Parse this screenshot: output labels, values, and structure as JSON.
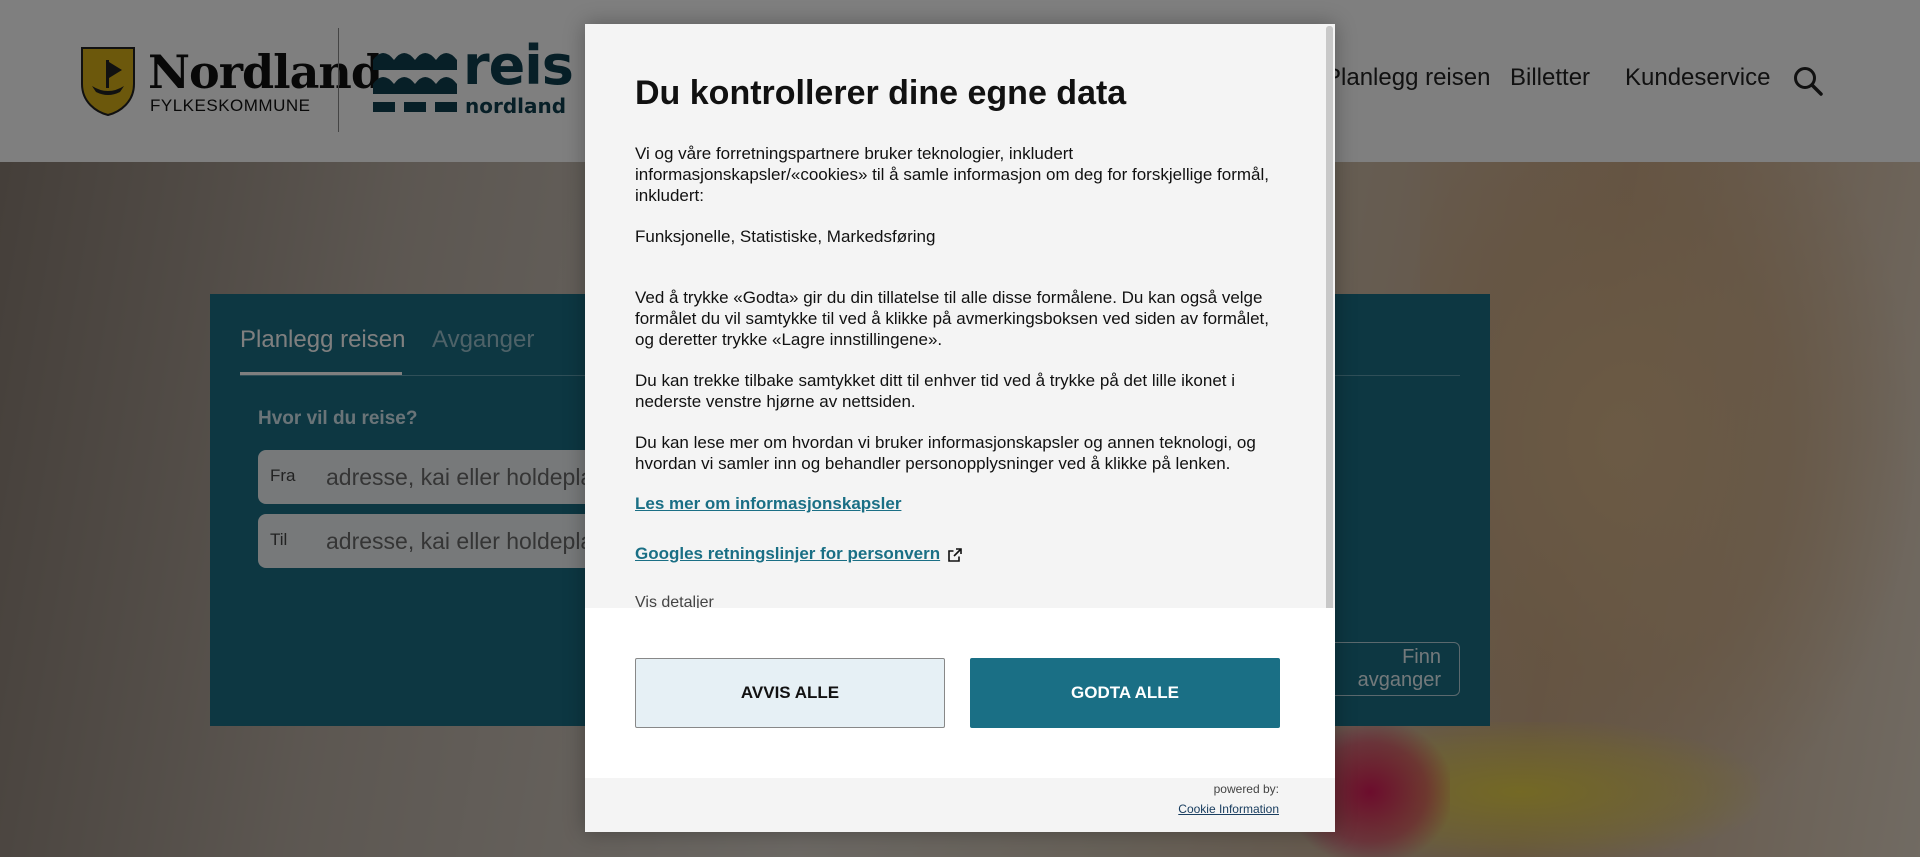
{
  "header": {
    "logo_nordland": "Nordland",
    "logo_fylke": "FYLKESKOMMUNE",
    "logo_reis": "reis",
    "logo_reis_sub": "nordland",
    "nav": {
      "planlegg": "Planlegg reisen",
      "billetter": "Billetter",
      "kundeservice": "Kundeservice"
    }
  },
  "planner": {
    "tabs": {
      "planlegg": "Planlegg reisen",
      "avganger": "Avganger"
    },
    "question": "Hvor vil du reise?",
    "from": {
      "label": "Fra",
      "placeholder": "adresse, kai eller holdeplass"
    },
    "to": {
      "label": "Til",
      "placeholder": "adresse, kai eller holdeplass"
    },
    "find_button": "Finn avganger"
  },
  "modal": {
    "title": "Du kontrollerer dine egne data",
    "intro": "Vi og våre forretningspartnere bruker teknologier, inkludert informasjonskapsler/«cookies» til å samle informasjon om deg for forskjellige formål, inkludert:",
    "purposes": "Funksjonelle, Statistiske, Markedsføring",
    "para_godta": "Ved å trykke «Godta» gir du din tillatelse til alle disse formålene. Du kan også velge formålet du vil samtykke til ved å klikke på avmerkingsboksen ved siden av formålet, og deretter trykke «Lagre innstillingene».",
    "para_withdraw": "Du kan trekke tilbake samtykket ditt til enhver tid ved å trykke på det lille ikonet i nederste venstre hjørne av nettsiden.",
    "para_more": "Du kan lese mer om hvordan vi bruker informasjonskapsler og annen teknologi, og hvordan vi samler inn og behandler personopplysninger ved å klikke på lenken.",
    "link_cookies": "Les mer om informasjonskapsler",
    "link_google": "Googles retningslinjer for personvern",
    "vis_detaljer": "Vis detaljer",
    "btn_avvis": "AVVIS ALLE",
    "btn_godta": "GODTA ALLE",
    "powered_by": "powered by:",
    "powered_link": "Cookie Information"
  },
  "colors": {
    "brand_teal": "#1a6f85",
    "dark_teal": "#0e3f4f"
  }
}
